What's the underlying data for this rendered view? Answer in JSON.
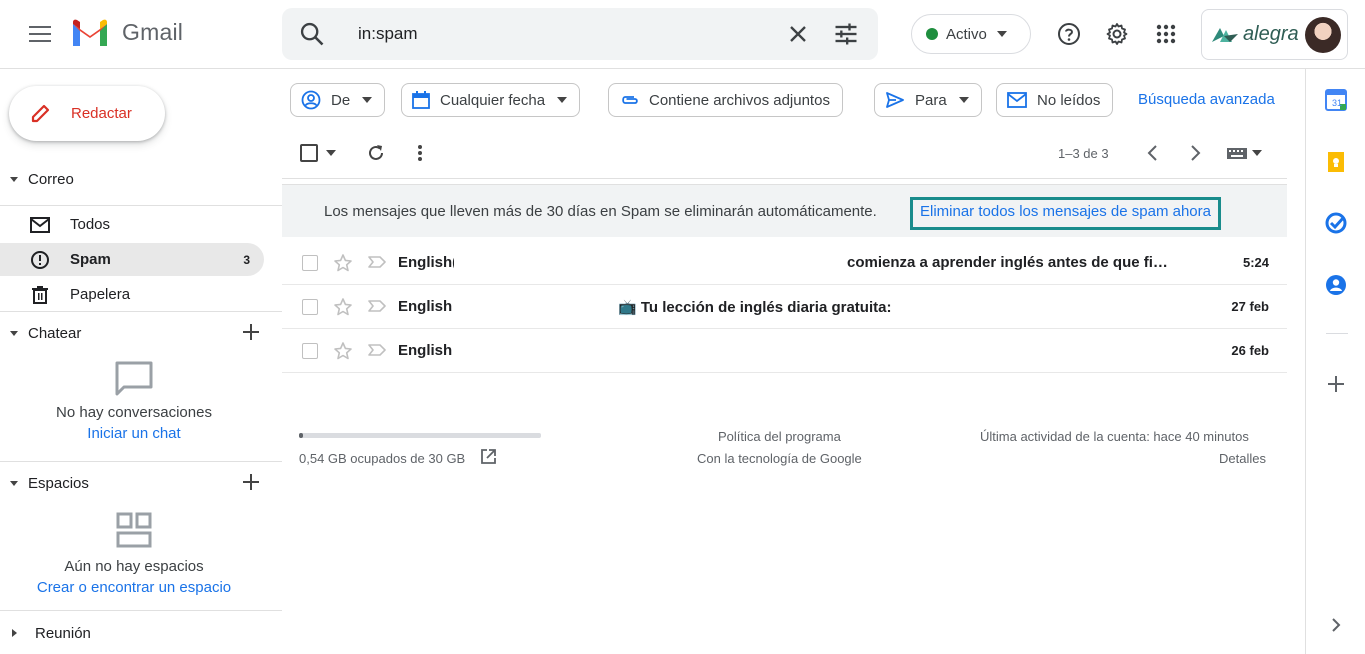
{
  "header": {
    "app_name": "Gmail",
    "search_value": "in:spam",
    "status_label": "Activo",
    "account_brand": "alegra"
  },
  "sidebar": {
    "compose_label": "Redactar",
    "mail_section": "Correo",
    "items": [
      {
        "label": "Todos",
        "icon": "mail-icon",
        "count": ""
      },
      {
        "label": "Spam",
        "icon": "report-spam-icon",
        "count": "3"
      },
      {
        "label": "Papelera",
        "icon": "trash-icon",
        "count": ""
      }
    ],
    "chat_section": "Chatear",
    "chat_empty": "No hay conversaciones",
    "chat_link": "Iniciar un chat",
    "spaces_section": "Espacios",
    "spaces_empty": "Aún no hay espacios",
    "spaces_link": "Crear o encontrar un espacio",
    "meeting_section": "Reunión"
  },
  "filters": {
    "from": "De",
    "date": "Cualquier fecha",
    "attachments": "Contiene archivos adjuntos",
    "to": "Para",
    "unread": "No leídos",
    "advanced": "Búsqueda avanzada"
  },
  "toolbar": {
    "pager": "1–3 de 3"
  },
  "banner": {
    "message": "Los mensajes que lleven más de 30 días en Spam se eliminarán automáticamente.",
    "delete_link": "Eliminar todos los mensajes de spam ahora"
  },
  "emails": [
    {
      "sender": "English(",
      "subject": "comienza a aprender inglés antes de que fi…",
      "date": "5:24"
    },
    {
      "sender": "English",
      "subject": "📺 Tu lección de inglés diaria gratuita:",
      "date": "27 feb"
    },
    {
      "sender": "English",
      "subject": "",
      "date": "26 feb"
    }
  ],
  "footer": {
    "storage_used_fraction": 0.018,
    "storage_text": "0,54 GB ocupados de 30 GB",
    "policy": "Política del programa",
    "powered": "Con la tecnología de Google",
    "last_activity": "Última actividad de la cuenta: hace 40 minutos",
    "details": "Detalles"
  },
  "colors": {
    "accent": "#1a73e8",
    "compose_text": "#d93025",
    "status_green": "#1e8e3e",
    "highlight_border": "#1a8c8c"
  }
}
